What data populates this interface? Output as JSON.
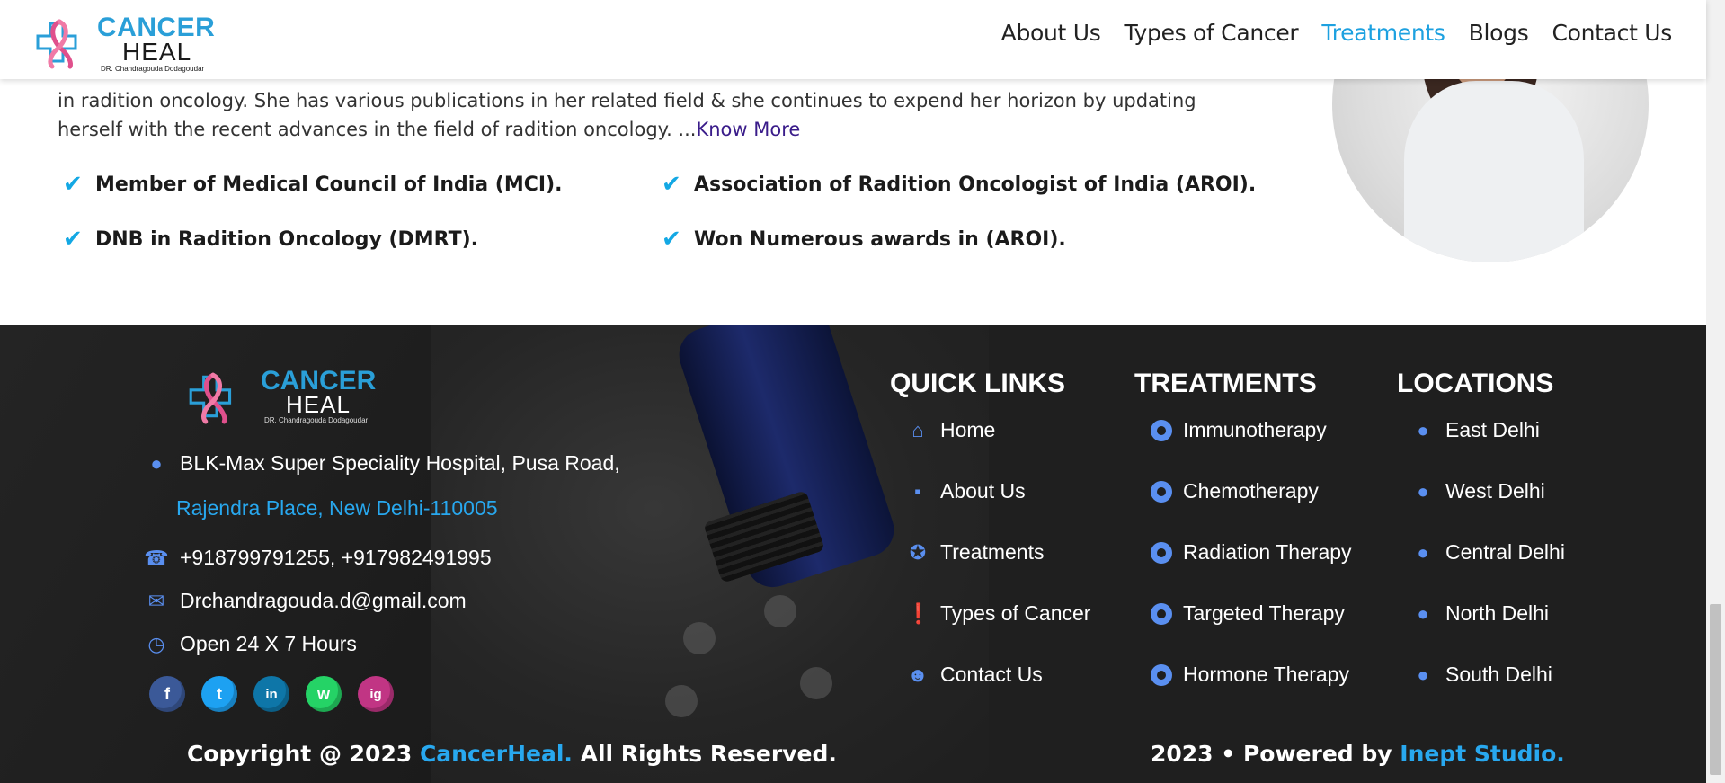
{
  "header": {
    "logo": {
      "title": "CANCER",
      "sub": "HEAL",
      "doctor": "DR. Chandragouda Dodagoudar"
    },
    "nav": [
      "About Us",
      "Types of Cancer",
      "Treatments",
      "Blogs",
      "Contact Us"
    ],
    "active_nav": "Treatments"
  },
  "doctor": {
    "bio_line1": "in radition oncology. She has various publications in her related field & she continues to expend her horizon by updating",
    "bio_line2": "herself with the recent advances in the field of radition oncology. ...",
    "know_more": "Know More",
    "credentials": [
      "Member of Medical Council of India (MCI).",
      "Association of Radition Oncologist of India (AROI).",
      "DNB in Radition Oncology (DMRT).",
      "Won Numerous awards in (AROI)."
    ]
  },
  "footer": {
    "logo": {
      "title": "CANCER",
      "sub": "HEAL",
      "doctor": "DR. Chandragouda Dodagoudar"
    },
    "address_line1": "BLK-Max Super Speciality Hospital, Pusa Road,",
    "address_line2": "Rajendra Place, New Delhi-110005",
    "phone": "+918799791255, +917982491995",
    "email": "Drchandragouda.d@gmail.com",
    "hours": "Open 24 X 7 Hours",
    "socials": [
      {
        "name": "facebook",
        "glyph": "f",
        "color": "#3b5998"
      },
      {
        "name": "twitter",
        "glyph": "t",
        "color": "#1da1f2"
      },
      {
        "name": "linkedin",
        "glyph": "in",
        "color": "#0e76a8"
      },
      {
        "name": "whatsapp",
        "glyph": "w",
        "color": "#25d366"
      },
      {
        "name": "instagram",
        "glyph": "ig",
        "color": "#c13584"
      }
    ],
    "quick_links": {
      "title": "QUICK LINKS",
      "items": [
        "Home",
        "About Us",
        "Treatments",
        "Types of Cancer",
        "Contact Us"
      ]
    },
    "treatments": {
      "title": "TREATMENTS",
      "items": [
        "Immunotherapy",
        "Chemotherapy",
        "Radiation Therapy",
        "Targeted Therapy",
        "Hormone Therapy"
      ]
    },
    "locations": {
      "title": "LOCATIONS",
      "items": [
        "East Delhi",
        "West Delhi",
        "Central Delhi",
        "North Delhi",
        "South Delhi"
      ]
    },
    "copyright_pre": "Copyright @ 2023 ",
    "copyright_brand": "CancerHeal.",
    "copyright_post": " All Rights Reserved.",
    "powered_pre": "2023 • Powered by ",
    "powered_brand": "Inept Studio."
  },
  "colors": {
    "accent": "#1da1e0",
    "icon": "#5a8ff0",
    "footer_bg": "#1f1f1f"
  }
}
